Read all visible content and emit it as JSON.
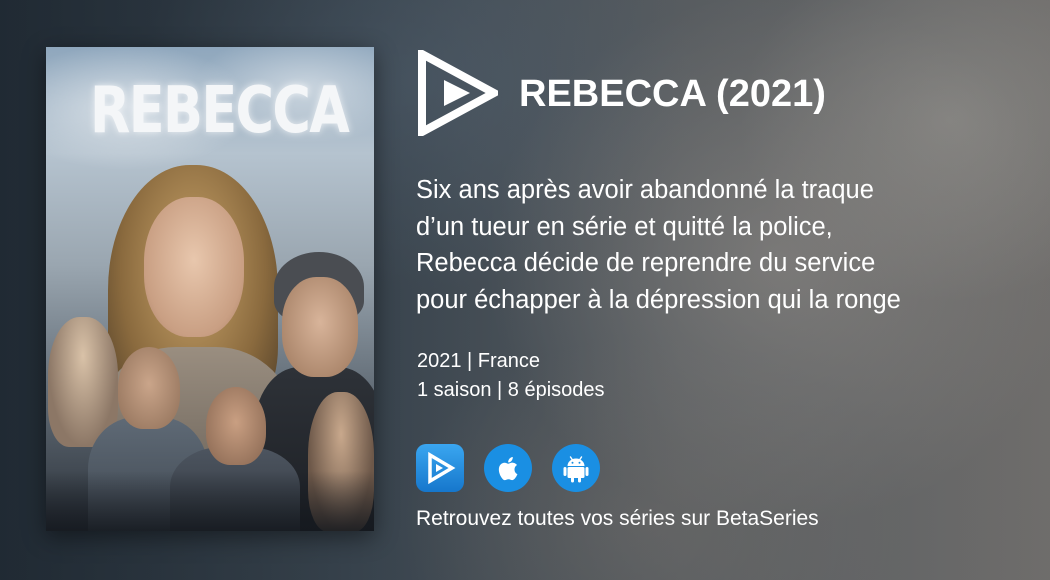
{
  "poster": {
    "title_text": "REBECCA",
    "icon": "series-poster-image"
  },
  "brand": {
    "logo_icon": "betaseries-logo-icon"
  },
  "show": {
    "title": "REBECCA (2021)",
    "synopsis_lines": [
      "Six ans après avoir abandonné la traque",
      "d’un tueur en série et quitté la police,",
      "Rebecca décide de reprendre du service",
      "pour échapper à la dépression qui la ronge"
    ],
    "meta_line1": "2021 | France",
    "meta_line2": "1 saison | 8 épisodes"
  },
  "apps": [
    {
      "name": "BetaSeries",
      "icon": "betaseries-app-icon",
      "color": "#1a8fe3"
    },
    {
      "name": "App Store",
      "icon": "apple-icon",
      "color": "#1a8fe3"
    },
    {
      "name": "Google Play",
      "icon": "android-icon",
      "color": "#1a8fe3"
    }
  ],
  "tagline": "Retrouvez toutes vos séries sur BetaSeries",
  "colors": {
    "text": "#ffffff",
    "accent": "#1a8fe3"
  }
}
